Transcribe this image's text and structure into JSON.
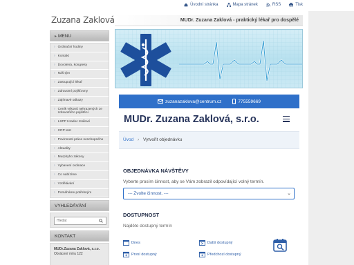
{
  "site": {
    "name": "Zuzana Zaklová"
  },
  "top_links": [
    {
      "label": "Úvodní stránka",
      "icon": "home-icon"
    },
    {
      "label": "Mapa stránek",
      "icon": "sitemap-icon"
    },
    {
      "label": "RSS",
      "icon": "rss-icon"
    },
    {
      "label": "Tisk",
      "icon": "print-icon"
    }
  ],
  "header": {
    "tagline": "MUDr. Zuzana Zaklová - praktický lékař pro dospělé"
  },
  "sidebar": {
    "menu_title": "Menu",
    "menu_items": [
      "Ordinační hodiny",
      "Kontakt",
      "Dovolená, kongresy",
      "Náš tým",
      "Zastupující lékař",
      "Zdravotní pojišťovny",
      "Zajímavé odkazy",
      "Ceník výkonů nehrazených ze zdravotního pojištění",
      "LSPP Hradec Králové",
      "CRP test",
      "Povinnosti práce neschopného",
      "Aktuality",
      "Murphyho zákony",
      "Vybavení ordinace",
      "Co nabízíme",
      "Vzdělávání",
      "Pomáháme potřebným"
    ],
    "search_title": "Vyhledávání",
    "search_placeholder": "Hledat",
    "contact_title": "Kontakt",
    "contact_name": "MUDr.Zuzana Zaklová, s.r.o.",
    "contact_address": "Obrácení míru 122"
  },
  "contact_bar": {
    "email": "zuzanazaklova@centrum.cz",
    "phone": "775559669"
  },
  "page": {
    "title": "MUDr. Zuzana Zaklová, s.r.o.",
    "breadcrumb_home": "Úvod",
    "breadcrumb_current": "Vytvořit objednávku"
  },
  "order": {
    "heading": "Objednávka návštěvy",
    "description": "Vyberte prosím činnost, aby se Vám zobrazil odpovídající volný termín.",
    "select_value": "--- Zvolte činnost. ---"
  },
  "availability": {
    "heading": "Dostupnost",
    "description": "Najděte dostupný termín",
    "slots": [
      "Dnes",
      "Další dostupný",
      "První dostupný",
      "Předchozí dostupný"
    ]
  },
  "colors": {
    "accent": "#2f70c9",
    "title": "#26335a",
    "banner": "#b8e1ef"
  }
}
